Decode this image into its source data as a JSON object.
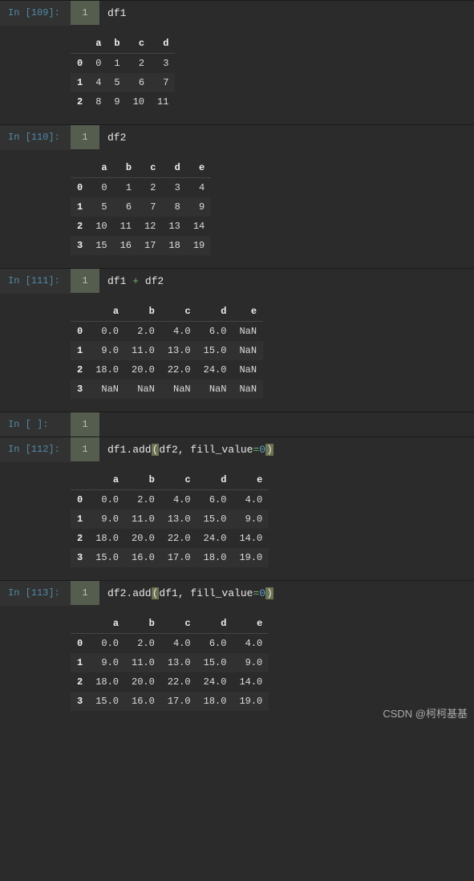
{
  "cells": [
    {
      "prompt": "In [109]:",
      "gutter": "1",
      "code_tokens": [
        {
          "t": "df1",
          "c": "fn"
        }
      ],
      "output_table": {
        "columns": [
          "a",
          "b",
          "c",
          "d"
        ],
        "index": [
          "0",
          "1",
          "2"
        ],
        "rows": [
          [
            "0",
            "1",
            "2",
            "3"
          ],
          [
            "4",
            "5",
            "6",
            "7"
          ],
          [
            "8",
            "9",
            "10",
            "11"
          ]
        ]
      }
    },
    {
      "prompt": "In [110]:",
      "gutter": "1",
      "code_tokens": [
        {
          "t": "df2",
          "c": "fn"
        }
      ],
      "output_table": {
        "columns": [
          "a",
          "b",
          "c",
          "d",
          "e"
        ],
        "index": [
          "0",
          "1",
          "2",
          "3"
        ],
        "rows": [
          [
            "0",
            "1",
            "2",
            "3",
            "4"
          ],
          [
            "5",
            "6",
            "7",
            "8",
            "9"
          ],
          [
            "10",
            "11",
            "12",
            "13",
            "14"
          ],
          [
            "15",
            "16",
            "17",
            "18",
            "19"
          ]
        ]
      }
    },
    {
      "prompt": "In [111]:",
      "gutter": "1",
      "code_tokens": [
        {
          "t": "df1 ",
          "c": "fn"
        },
        {
          "t": "+",
          "c": "op"
        },
        {
          "t": " df2",
          "c": "fn"
        }
      ],
      "output_table": {
        "columns": [
          "a",
          "b",
          "c",
          "d",
          "e"
        ],
        "index": [
          "0",
          "1",
          "2",
          "3"
        ],
        "rows": [
          [
            "0.0",
            "2.0",
            "4.0",
            "6.0",
            "NaN"
          ],
          [
            "9.0",
            "11.0",
            "13.0",
            "15.0",
            "NaN"
          ],
          [
            "18.0",
            "20.0",
            "22.0",
            "24.0",
            "NaN"
          ],
          [
            "NaN",
            "NaN",
            "NaN",
            "NaN",
            "NaN"
          ]
        ]
      }
    },
    {
      "prompt": "In [ ]:",
      "gutter": "1",
      "code_tokens": [],
      "output_table": null
    },
    {
      "prompt": "In [112]:",
      "gutter": "1",
      "code_tokens": [
        {
          "t": "df1.add",
          "c": "fn"
        },
        {
          "t": "(",
          "c": "paren-hl"
        },
        {
          "t": "df2, fill_value",
          "c": "fn"
        },
        {
          "t": "=",
          "c": "op"
        },
        {
          "t": "0",
          "c": "num"
        },
        {
          "t": ")",
          "c": "paren-hl"
        }
      ],
      "output_table": {
        "columns": [
          "a",
          "b",
          "c",
          "d",
          "e"
        ],
        "index": [
          "0",
          "1",
          "2",
          "3"
        ],
        "rows": [
          [
            "0.0",
            "2.0",
            "4.0",
            "6.0",
            "4.0"
          ],
          [
            "9.0",
            "11.0",
            "13.0",
            "15.0",
            "9.0"
          ],
          [
            "18.0",
            "20.0",
            "22.0",
            "24.0",
            "14.0"
          ],
          [
            "15.0",
            "16.0",
            "17.0",
            "18.0",
            "19.0"
          ]
        ]
      }
    },
    {
      "prompt": "In [113]:",
      "gutter": "1",
      "code_tokens": [
        {
          "t": "df2.add",
          "c": "fn"
        },
        {
          "t": "(",
          "c": "paren-hl"
        },
        {
          "t": "df1, fill_value",
          "c": "fn"
        },
        {
          "t": "=",
          "c": "op"
        },
        {
          "t": "0",
          "c": "num"
        },
        {
          "t": ")",
          "c": "paren-hl"
        }
      ],
      "output_table": {
        "columns": [
          "a",
          "b",
          "c",
          "d",
          "e"
        ],
        "index": [
          "0",
          "1",
          "2",
          "3"
        ],
        "rows": [
          [
            "0.0",
            "2.0",
            "4.0",
            "6.0",
            "4.0"
          ],
          [
            "9.0",
            "11.0",
            "13.0",
            "15.0",
            "9.0"
          ],
          [
            "18.0",
            "20.0",
            "22.0",
            "24.0",
            "14.0"
          ],
          [
            "15.0",
            "16.0",
            "17.0",
            "18.0",
            "19.0"
          ]
        ]
      }
    }
  ],
  "watermark": "CSDN @柯柯基基"
}
